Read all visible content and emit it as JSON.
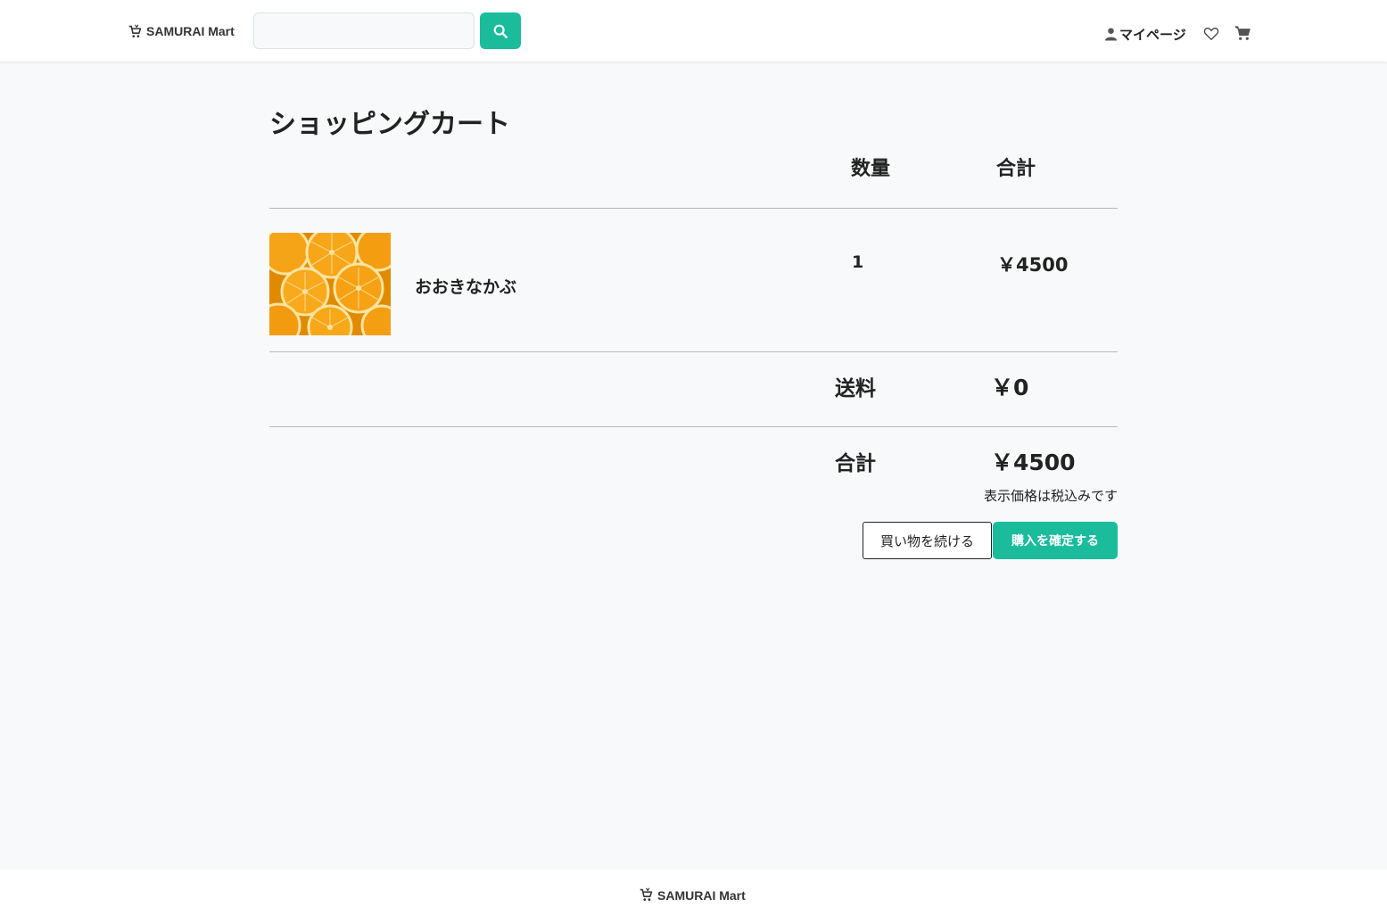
{
  "header": {
    "logo_text": "SAMURAI Mart",
    "search": {
      "value": "",
      "placeholder": ""
    },
    "mypage_label": "マイページ"
  },
  "cart": {
    "title": "ショッピングカート",
    "columns": {
      "quantity": "数量",
      "total": "合計"
    },
    "items": [
      {
        "name": "おおきなかぶ",
        "quantity": "1",
        "price": "￥4500",
        "image": "orange-slices"
      }
    ],
    "shipping": {
      "label": "送料",
      "value": "￥0"
    },
    "grand_total": {
      "label": "合計",
      "value": "￥4500"
    },
    "tax_note": "表示価格は税込みです",
    "continue_label": "買い物を続ける",
    "purchase_label": "購入を確定する"
  },
  "footer": {
    "logo_text": "SAMURAI Mart"
  },
  "colors": {
    "accent": "#1abc9c",
    "background": "#f8f9fa",
    "header_bg": "#ffffff",
    "text": "#222222"
  }
}
